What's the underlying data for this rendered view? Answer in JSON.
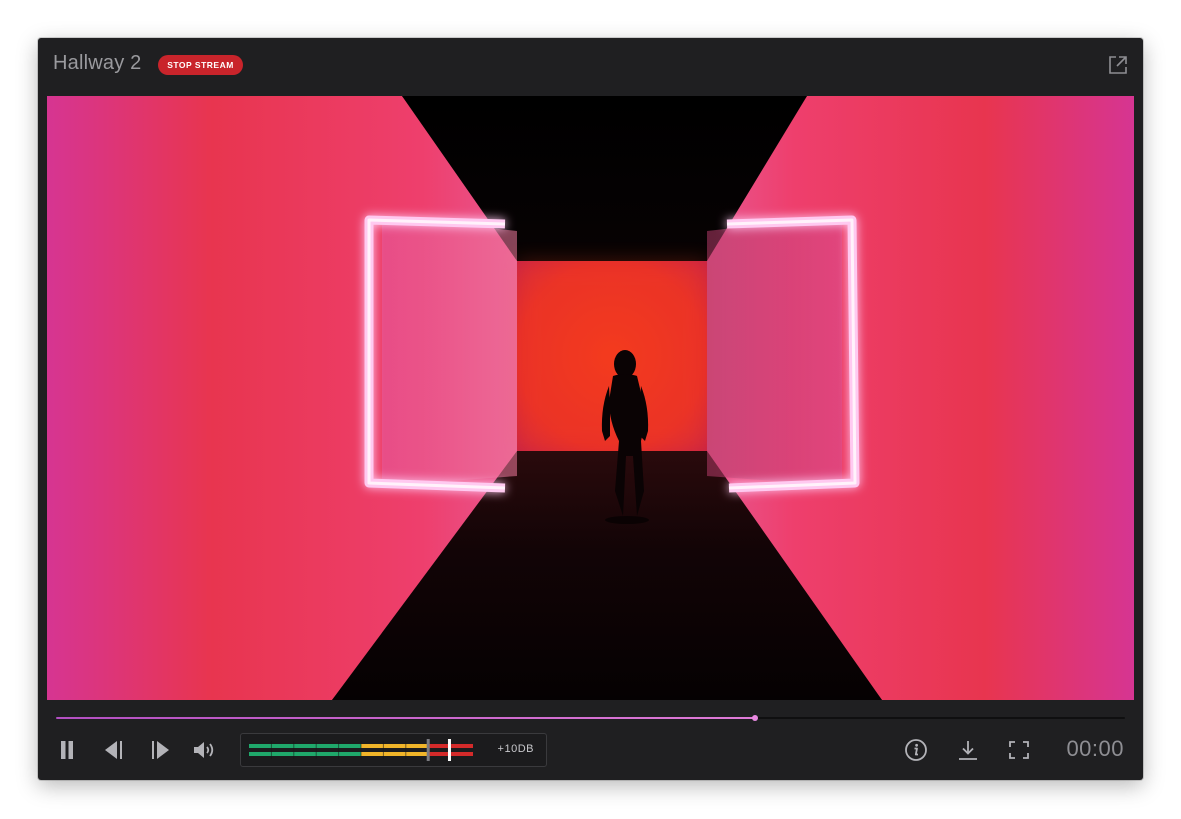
{
  "window": {
    "title": "Hallway 2",
    "stop_label": "STOP STREAM"
  },
  "playback": {
    "progress": 0.654,
    "time": "00:00"
  },
  "audio": {
    "gain_label": "+10DB",
    "level": 0.895,
    "level_markers": [
      0.8,
      0.895
    ]
  },
  "icons": {
    "popout": "external-link-icon",
    "pause": "pause-icon",
    "prev": "step-back-icon",
    "next": "step-forward-icon",
    "volume": "volume-icon",
    "info": "info-icon",
    "download": "download-icon",
    "fullscreen": "fullscreen-icon"
  },
  "colors": {
    "accent": "#c9242b",
    "progress": "#d46bd0",
    "meter_green": "#1fa86b",
    "meter_yellow": "#f0b429",
    "meter_red": "#d42a2a"
  }
}
